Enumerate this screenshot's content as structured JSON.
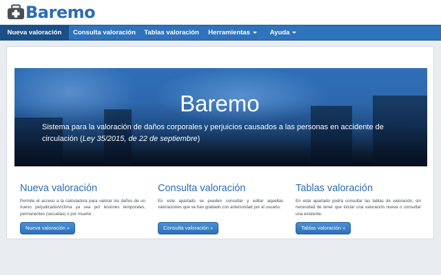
{
  "header": {
    "logo_icon": "medical-case-icon",
    "logo_text": "Baremo"
  },
  "nav": {
    "items": [
      {
        "label": "Nueva valoración"
      },
      {
        "label": "Consulta valoración"
      },
      {
        "label": "Tablas valoración"
      },
      {
        "label": "Herramientas"
      },
      {
        "label": "Ayuda"
      }
    ],
    "dropdown_icon": "caret-down-icon"
  },
  "hero": {
    "title": "Baremo",
    "description_main": "Sistema para la valoración de daños corporales y perjuicios causados a las personas en accidente de circulación",
    "description_law": "Ley 35/2015, de 22 de septiembre",
    "description_open": " (",
    "description_close": ")"
  },
  "columns": [
    {
      "title": "Nueva valoración",
      "text": "Permite el acceso a la calculadora para valorar los daños de un nuevo perjudicado/víctima ya sea por lesiones temporales, permanentes (secuelas) o por muerte.",
      "button": "Nueva valoración »"
    },
    {
      "title": "Consulta valoración",
      "text": "En este apartado se pueden consultar y editar aquellas valoraciones que se han grabado con anterioridad por el usuario.",
      "button": "Consulta valoración »"
    },
    {
      "title": "Tablas valoración",
      "text": "En este apartado podrá consultar las tablas de valoración, sin necesidad de tener que iniciar una valoración nueva o consultar una existente.",
      "button": "Tablas valoración »"
    }
  ],
  "colors": {
    "brand": "#2a6cb3",
    "navbar": "#2f73bd",
    "nav_active": "#1b4f88",
    "button": "#2d70b8"
  }
}
